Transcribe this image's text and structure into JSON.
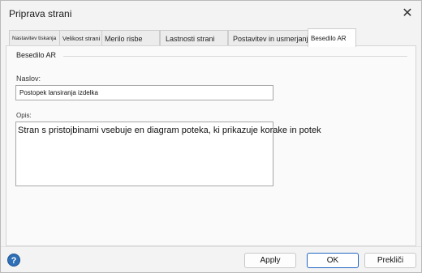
{
  "window": {
    "title": "Priprava strani",
    "close_glyph": "✕"
  },
  "tabs": [
    {
      "label": "Nastavitev tiskanja",
      "active": false
    },
    {
      "label": "Velikost strani",
      "active": false
    },
    {
      "label": "Merilo risbe",
      "active": false
    },
    {
      "label": "Lastnosti strani",
      "active": false
    },
    {
      "label": "Postavitev in usmerjanje",
      "active": false
    },
    {
      "label": "Besedilo AR",
      "active": true
    }
  ],
  "panel": {
    "section_title": "Besedilo AR",
    "title_label": "Naslov:",
    "title_value": "Postopek lansiranja izdelka",
    "desc_label": "Opis:",
    "desc_value": "Stran s pristojbinami vsebuje en diagram poteka, ki prikazuje korake in potek"
  },
  "footer": {
    "help_icon": "help-icon",
    "help_glyph": "?",
    "apply_label": "Apply",
    "ok_label": "OK",
    "cancel_label": "Prekliči"
  },
  "colors": {
    "accent": "#2166c2",
    "help": "#2f6fb6"
  }
}
